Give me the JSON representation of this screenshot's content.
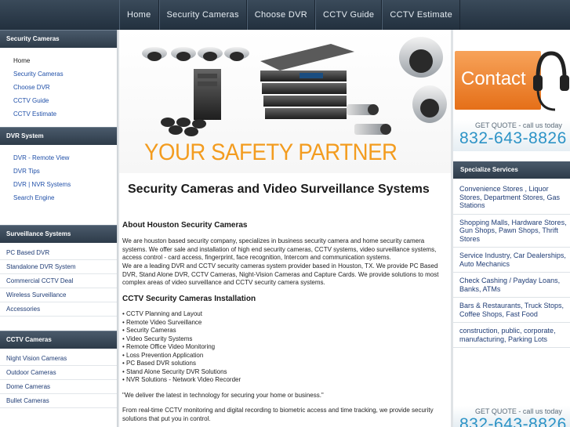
{
  "topnav": [
    "Home",
    "Security Cameras",
    "Choose DVR",
    "CCTV Guide",
    "CCTV Estimate"
  ],
  "left": {
    "security_cameras": {
      "title": "Security Cameras",
      "links": [
        "Home",
        "Security Cameras",
        "Choose DVR",
        "CCTV Guide",
        "CCTV Estimate"
      ]
    },
    "dvr_system": {
      "title": "DVR System",
      "links": [
        "DVR - Remote View",
        "DVR Tips",
        "DVR | NVR Systems",
        "Search Engine"
      ]
    },
    "surveillance_systems": {
      "title": "Surveillance Systems",
      "links": [
        "PC Based DVR",
        "Standalone DVR System",
        "Commercial CCTV Deal",
        "Wireless Surveillance",
        "Accessories"
      ]
    },
    "cctv_cameras": {
      "title": "CCTV Cameras",
      "links": [
        "Night Vision Cameras",
        "Outdoor Cameras",
        "Dome Cameras",
        "Bullet Cameras"
      ]
    }
  },
  "banner": {
    "slogan": "YOUR SAFETY PARTNER"
  },
  "content": {
    "title": "Security Cameras and Video Surveillance Systems",
    "about_heading": "About Houston Security Cameras",
    "about_p1": "We are houston based security company, specializes in business security camera and home security camera systems. We offer sale and installation of high end security cameras, CCTV systems, video surveillance systems, access control - card access, fingerprint, face recognition, Intercom and communication systems.",
    "about_p2": "We are a leading DVR and CCTV security cameras system provider based in Houston, TX. We provide PC Based DVR, Stand Alone DVR, CCTV Cameras, Night-Vision Cameras and Capture Cards. We provide solutions to most complex areas of video surveillance and CCTV security camera systems.",
    "install_heading": "CCTV Security Cameras Installation",
    "install_items": [
      "• CCTV Planning and Layout",
      "• Remote Video Surveillance",
      "• Security Cameras",
      "• Video Security Systems",
      "• Remote Office Video Monitoring",
      "• Loss Prevention Application",
      "• PC Based DVR solutions",
      "• Stand Alone Security DVR Solutions",
      "• NVR Solutions - Network Video Recorder"
    ],
    "quote": "\"We deliver the latest in technology for securing your home or business.\"",
    "closing": "From real-time CCTV monitoring and digital recording to biometric access and time tracking, we provide security solutions that put you in control."
  },
  "right": {
    "contact_label": "Contact",
    "quote_label": "GET QUOTE - call us today",
    "phone": "832-643-8826",
    "specialize_title": "Specialize Services",
    "specialize_items": [
      "Convenience Stores , Liquor Stores, Department Stores, Gas Stations",
      "Shopping Malls, Hardware Stores, Gun Shops, Pawn Shops, Thrift Stores",
      "Service Industry, Car Dealerships, Auto Mechanics",
      "Check Cashing / Payday Loans, Banks, ATMs",
      "Bars & Restaurants, Truck Stops, Coffee Shops, Fast Food",
      "construction, public, corporate, manufacturing, Parking Lots"
    ]
  },
  "colors": {
    "accent_orange": "#f39c1f",
    "phone_blue": "#2c93c6",
    "nav_dark": "#2d3b49",
    "link_blue": "#1f4fa8"
  }
}
